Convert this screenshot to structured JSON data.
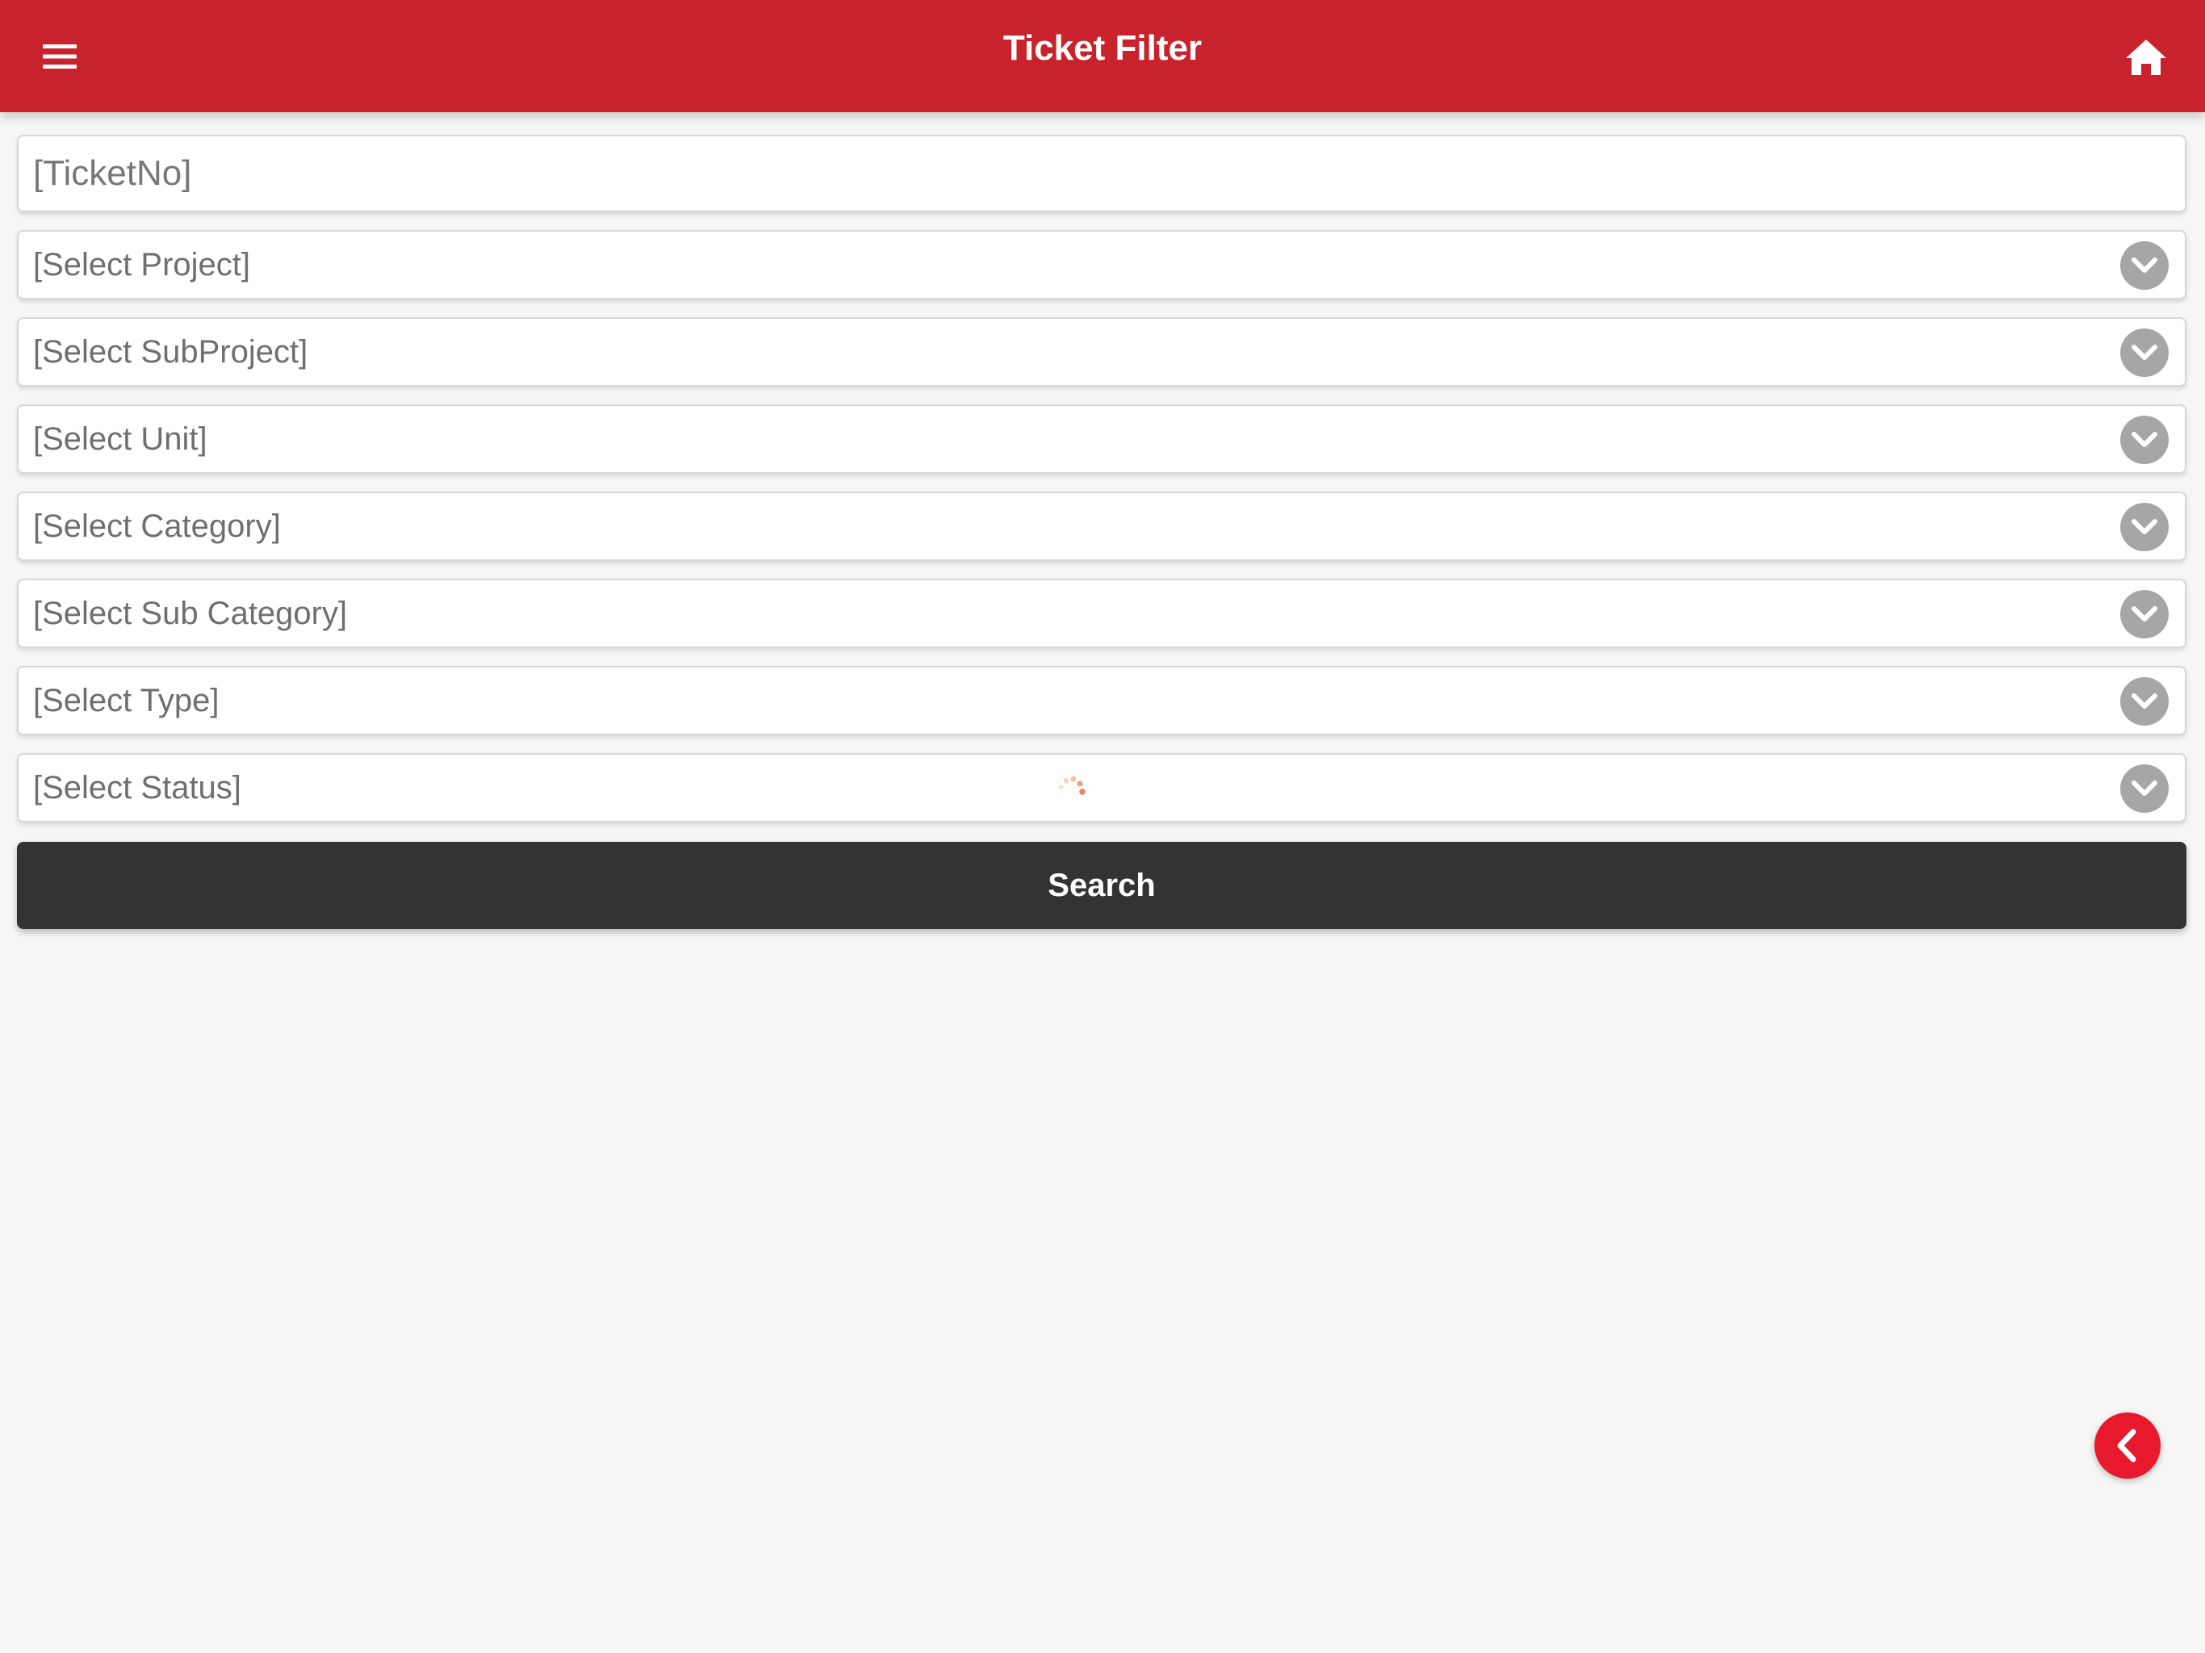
{
  "header": {
    "title": "Ticket Filter",
    "menu_icon": "hamburger-menu-icon",
    "home_icon": "home-icon",
    "background_color": "#c8232c"
  },
  "form": {
    "ticket_no": {
      "placeholder": "[TicketNo]",
      "value": ""
    },
    "selects": [
      {
        "label": "[Select Project]"
      },
      {
        "label": "[Select SubProject]"
      },
      {
        "label": "[Select Unit]"
      },
      {
        "label": "[Select Category]"
      },
      {
        "label": "[Select Sub Category]"
      },
      {
        "label": "[Select Type]"
      },
      {
        "label": "[Select Status]"
      }
    ],
    "search_label": "Search"
  },
  "back_button": {
    "icon": "chevron-left-icon",
    "color": "#e8192c"
  }
}
